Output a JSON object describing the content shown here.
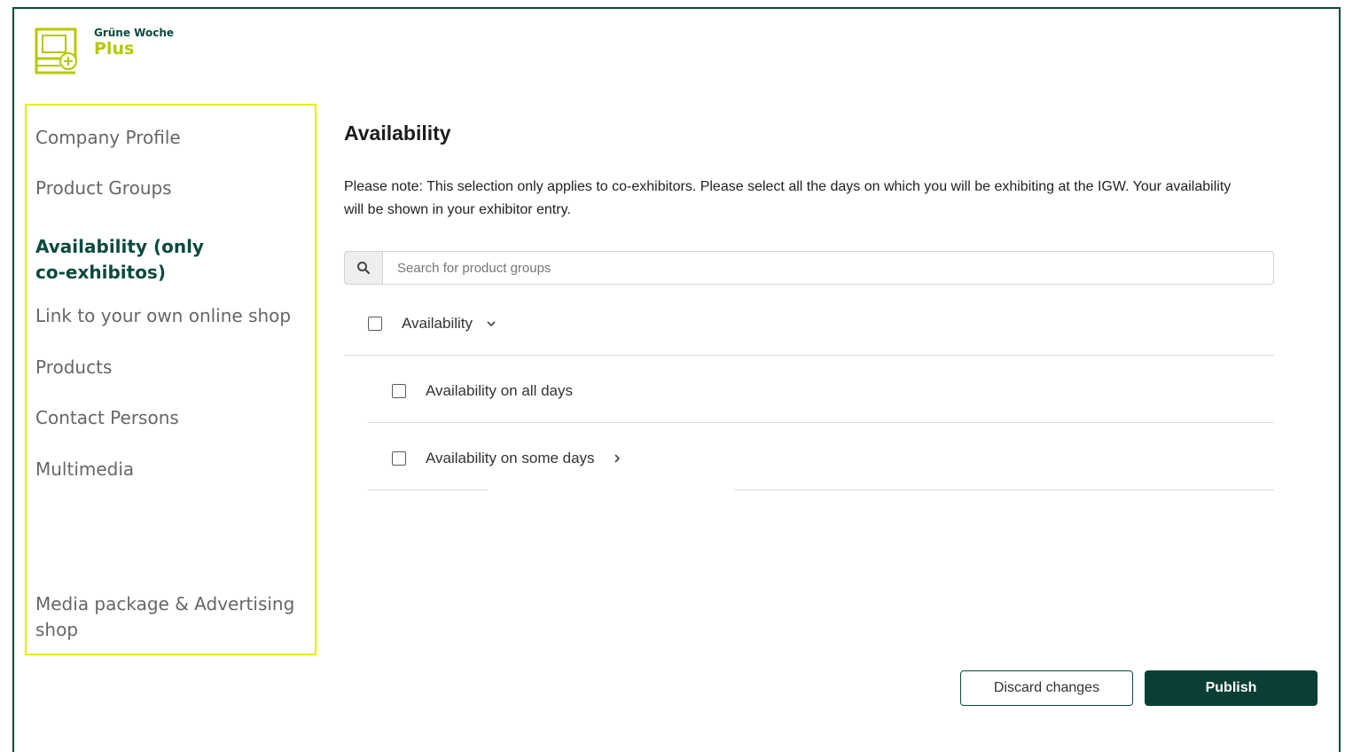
{
  "brand": {
    "small": "Grüne Woche",
    "big": "Plus"
  },
  "sidebar": {
    "items": [
      {
        "label": "Company Profile"
      },
      {
        "label": "Product Groups"
      },
      {
        "label": "Availability (only co-exhibitos)",
        "active": true
      },
      {
        "label": "Link to your own online shop"
      },
      {
        "label": "Products"
      },
      {
        "label": "Contact Persons"
      },
      {
        "label": "Multimedia"
      },
      {
        "label": "Media package & Advertising shop"
      }
    ]
  },
  "main": {
    "title": "Availability",
    "note": "Please note: This selection only applies to co-exhibitors. Please select all the days on which you will be exhibiting at the IGW. Your availability will be shown in your exhibitor entry.",
    "search": {
      "placeholder": "Search for product groups",
      "value": "",
      "icon": "search-icon"
    },
    "tree": {
      "parent": {
        "label": "Availability",
        "checked": false,
        "expanded": true,
        "icon": "chevron-down-icon"
      },
      "children": [
        {
          "label": "Availability on all days",
          "checked": false
        },
        {
          "label": "Availability on some days",
          "checked": false,
          "icon": "chevron-right-icon"
        }
      ]
    }
  },
  "actions": {
    "discard_label": "Discard changes",
    "publish_label": "Publish"
  },
  "colors": {
    "brand_dark": "#0b4a3e",
    "brand_lime": "#b4c800",
    "sidebar_border": "#e4ee00",
    "publish_bg": "#0b3f35"
  }
}
